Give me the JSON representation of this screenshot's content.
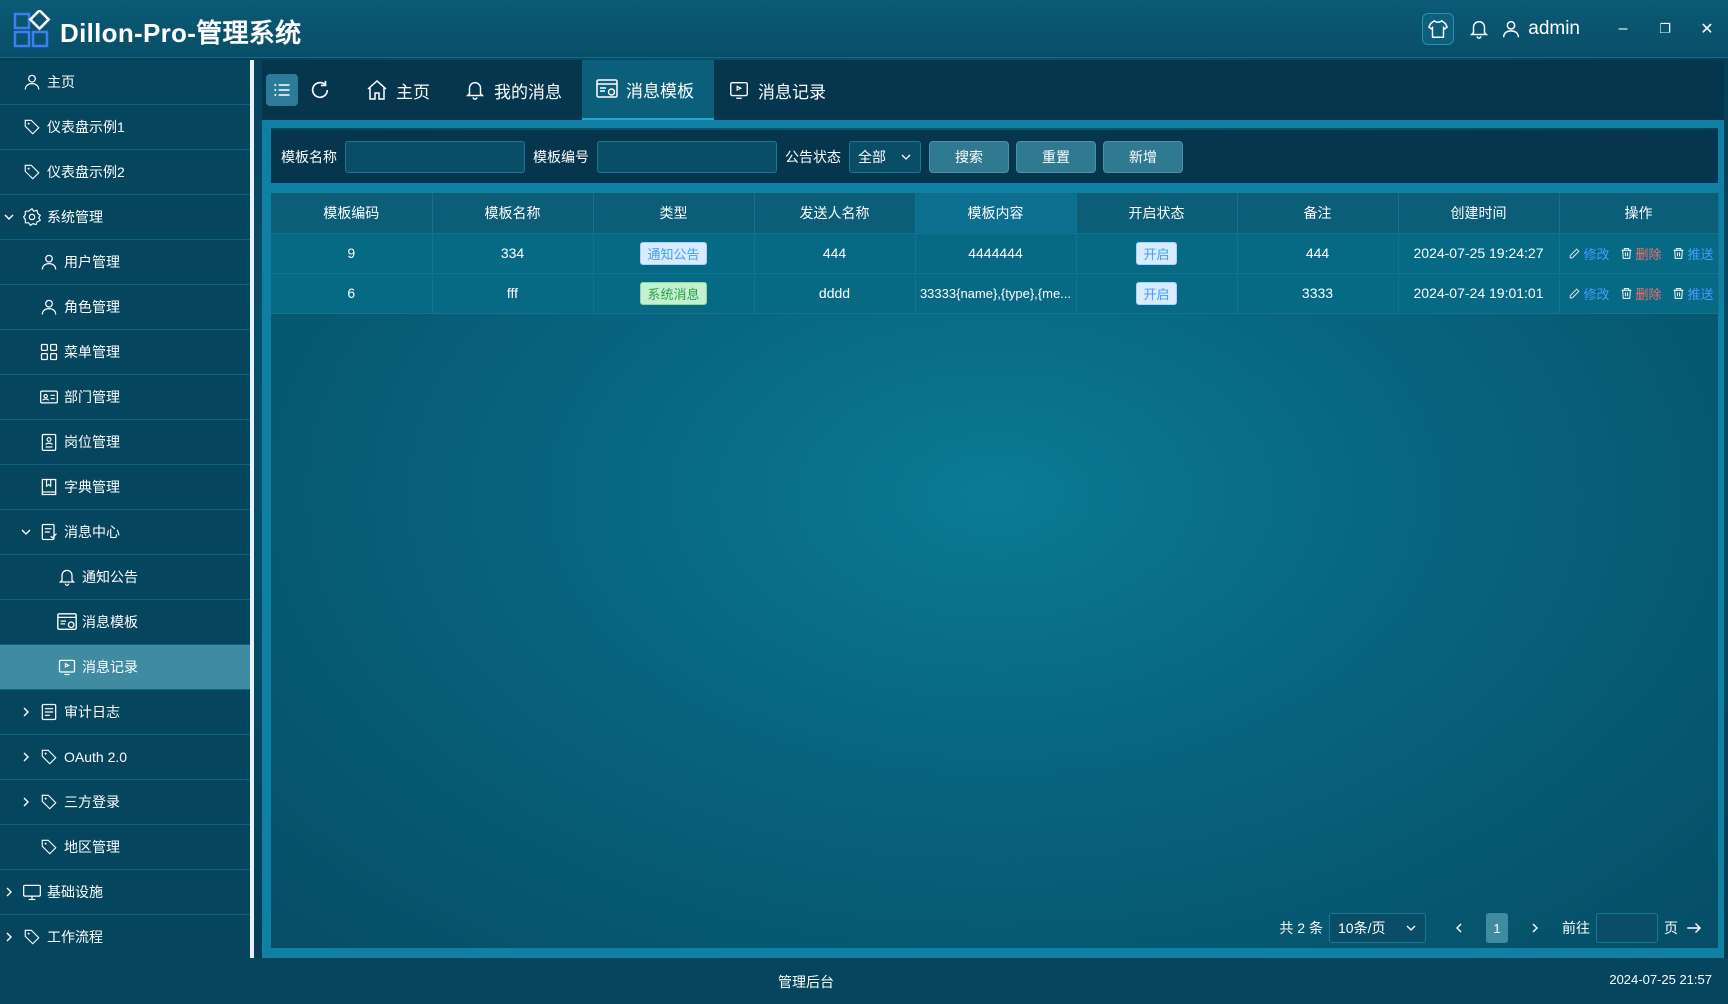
{
  "header": {
    "title": "Dillon-Pro-管理系统",
    "username": "admin",
    "minimize": "–",
    "restore": "❐",
    "close": "✕"
  },
  "sidebar": {
    "items": [
      {
        "label": "主页",
        "icon": "user-icon"
      },
      {
        "label": "仪表盘示例1",
        "icon": "tag-icon"
      },
      {
        "label": "仪表盘示例2",
        "icon": "tag-icon"
      },
      {
        "label": "系统管理",
        "icon": "gear-icon",
        "expanded": true
      },
      {
        "label": "用户管理",
        "icon": "user-icon"
      },
      {
        "label": "角色管理",
        "icon": "user-icon"
      },
      {
        "label": "菜单管理",
        "icon": "grid-icon"
      },
      {
        "label": "部门管理",
        "icon": "id-card-icon"
      },
      {
        "label": "岗位管理",
        "icon": "clipboard-user-icon"
      },
      {
        "label": "字典管理",
        "icon": "book-icon"
      },
      {
        "label": "消息中心",
        "icon": "document-icon",
        "expanded": true
      },
      {
        "label": "通知公告",
        "icon": "bell-icon"
      },
      {
        "label": "消息模板",
        "icon": "template-icon"
      },
      {
        "label": "消息记录",
        "icon": "message-record-icon",
        "active": true
      },
      {
        "label": "审计日志",
        "icon": "log-icon"
      },
      {
        "label": "OAuth 2.0",
        "icon": "tag-icon"
      },
      {
        "label": "三方登录",
        "icon": "tag-icon"
      },
      {
        "label": "地区管理",
        "icon": "tag-icon"
      },
      {
        "label": "基础设施",
        "icon": "monitor-icon"
      },
      {
        "label": "工作流程",
        "icon": "tag-icon"
      }
    ]
  },
  "tabs": [
    {
      "label": "主页",
      "icon": "home-icon"
    },
    {
      "label": "我的消息",
      "icon": "bell-icon"
    },
    {
      "label": "消息模板",
      "icon": "template-icon",
      "active": true
    },
    {
      "label": "消息记录",
      "icon": "message-record-icon"
    }
  ],
  "search": {
    "name_label": "模板名称",
    "name_value": "",
    "code_label": "模板编号",
    "code_value": "",
    "status_label": "公告状态",
    "status_value": "全部",
    "search_btn": "搜索",
    "reset_btn": "重置",
    "add_btn": "新增"
  },
  "table": {
    "columns": [
      "模板编码",
      "模板名称",
      "类型",
      "发送人名称",
      "模板内容",
      "开启状态",
      "备注",
      "创建时间",
      "操作"
    ],
    "rows": [
      {
        "code": "9",
        "name": "334",
        "type": "通知公告",
        "sender": "444",
        "content": "4444444",
        "status": "开启",
        "remark": "444",
        "created": "2024-07-25 19:24:27"
      },
      {
        "code": "6",
        "name": "fff",
        "type": "系统消息",
        "sender": "dddd",
        "content": "33333{name},{type},{me...",
        "status": "开启",
        "remark": "3333",
        "created": "2024-07-24 19:01:01"
      }
    ],
    "ops": {
      "edit": "修改",
      "delete": "删除",
      "push": "推送"
    }
  },
  "pager": {
    "total": "共 2 条",
    "page_size": "10条/页",
    "current": "1",
    "goto_prefix": "前往",
    "goto_suffix": "页"
  },
  "footer": {
    "center": "管理后台",
    "datetime": "2024-07-25 21:57"
  },
  "colors": {
    "accent": "#0f7fa3",
    "link": "#409eff",
    "danger": "#f56c6c",
    "active_menu": "#3f8ca2"
  }
}
